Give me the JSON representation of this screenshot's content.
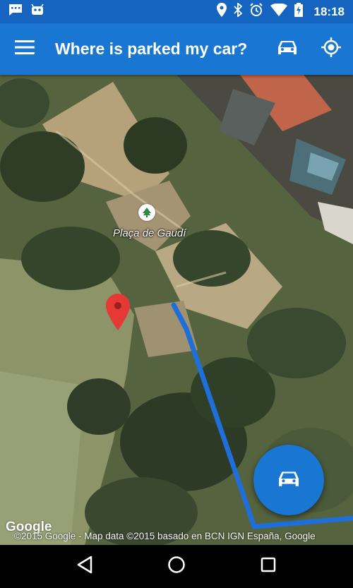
{
  "status_bar": {
    "time": "18:18",
    "left_icons": [
      "chat-notification-icon",
      "android-robot-icon"
    ],
    "right_icons": [
      "location-pin-icon",
      "bluetooth-icon",
      "alarm-icon",
      "wifi-icon",
      "battery-charging-icon"
    ]
  },
  "app_bar": {
    "title": "Where is parked my car?",
    "menu_icon": "hamburger-menu-icon",
    "actions": [
      "car-icon",
      "my-location-icon"
    ],
    "color": "#1976D2"
  },
  "map": {
    "place_label": "Plaça de Gaudí",
    "place_icon": "park-tree-icon",
    "marker_color": "#E53935",
    "route_color": "#1E6FD9",
    "google_logo": "Google",
    "attribution": "©2015 Google - Map data ©2015 basado en BCN IGN España, Google"
  },
  "fab": {
    "icon": "car-icon",
    "color": "#1976D2"
  },
  "nav_bar": {
    "buttons": [
      "back-icon",
      "home-icon",
      "recents-icon"
    ]
  }
}
